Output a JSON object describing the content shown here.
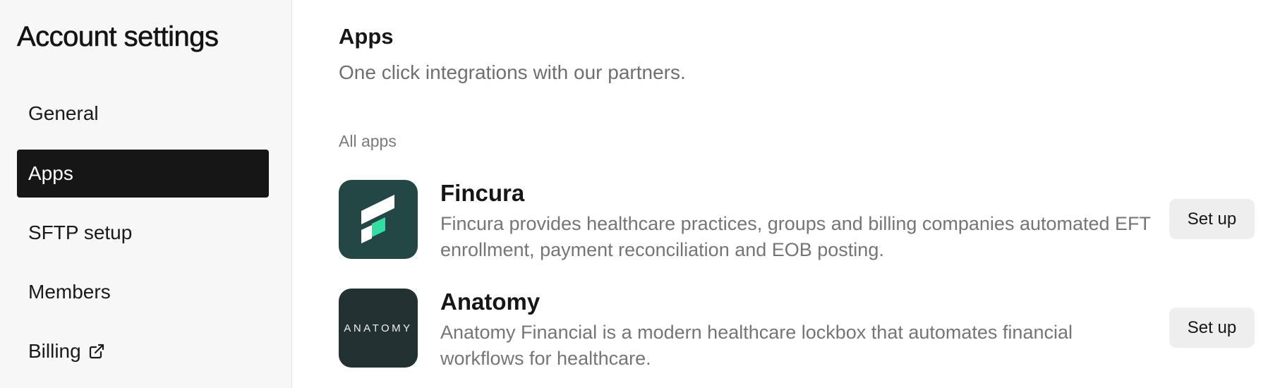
{
  "sidebar": {
    "title": "Account settings",
    "items": [
      {
        "label": "General"
      },
      {
        "label": "Apps"
      },
      {
        "label": "SFTP setup"
      },
      {
        "label": "Members"
      },
      {
        "label": "Billing"
      }
    ],
    "active_item": "Apps"
  },
  "main": {
    "title": "Apps",
    "subtitle": "One click integrations with our partners.",
    "group_label": "All apps",
    "apps": [
      {
        "name": "Fincura",
        "description": "Fincura provides healthcare practices, groups and billing companies automated EFT enrollment, payment reconciliation and EOB posting.",
        "button_label": "Set up",
        "logo_color": "#234744"
      },
      {
        "name": "Anatomy",
        "description": "Anatomy Financial is a modern healthcare lockbox that automates financial workflows for healthcare.",
        "button_label": "Set up",
        "logo_text": "ANATOMY",
        "logo_color": "#243132"
      }
    ]
  },
  "colors": {
    "active_nav_bg": "#161616",
    "fincura_accent": "#2fe0a0",
    "button_bg": "#eeeeee"
  }
}
